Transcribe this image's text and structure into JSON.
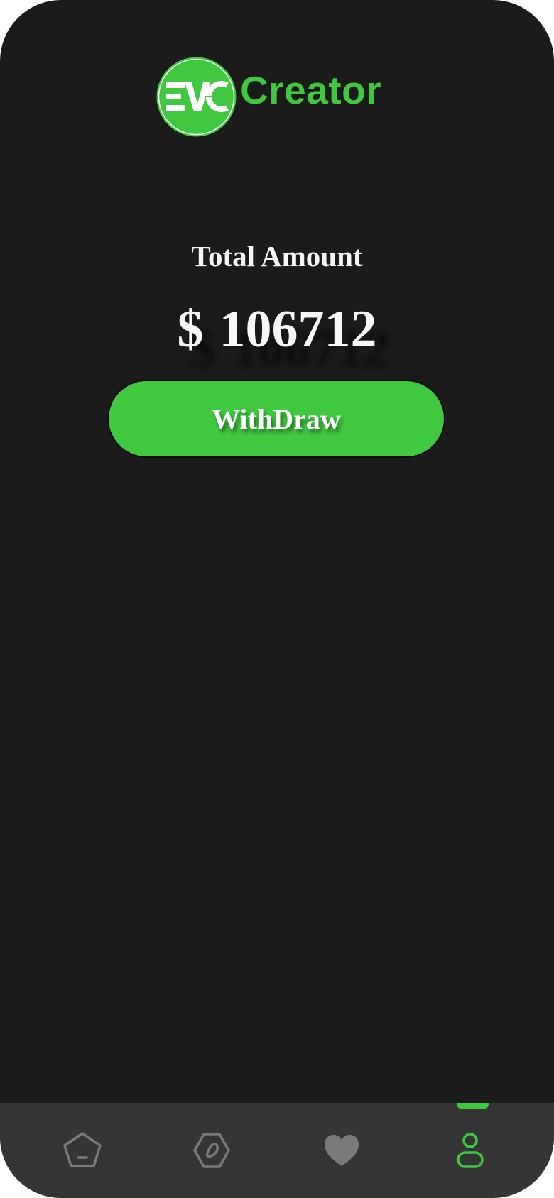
{
  "brand": {
    "name": "Creator",
    "badge_text": "EVC",
    "color": "#41c841"
  },
  "balance": {
    "label": "Total Amount",
    "currency": "$",
    "value": "106712"
  },
  "actions": {
    "withdraw_label": "WithDraw"
  },
  "nav": {
    "items": [
      {
        "id": "home",
        "icon": "home-icon",
        "active": false
      },
      {
        "id": "explore",
        "icon": "compass-icon",
        "active": false
      },
      {
        "id": "favorites",
        "icon": "heart-icon",
        "active": false
      },
      {
        "id": "profile",
        "icon": "user-icon",
        "active": true
      }
    ],
    "active_color": "#41c841",
    "inactive_color": "#7a7a7a"
  },
  "colors": {
    "background": "#1b1b1b",
    "nav_background": "#353535",
    "accent": "#41c841"
  }
}
